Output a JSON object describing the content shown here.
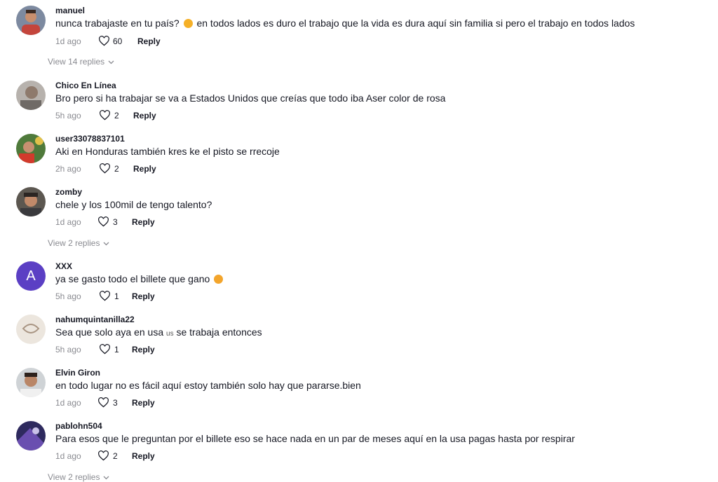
{
  "comments": [
    {
      "username": "manuel",
      "text_before": "nunca trabajaste en tu país?",
      "emoji": "laughing-face-emoji",
      "text_after": " en todos lados es duro el trabajo que la vida es dura aquí sin familia si pero el trabajo en todos lados",
      "time": "1d ago",
      "likes": "60",
      "reply": "Reply",
      "avatar": "photo"
    },
    {
      "username": "Chico En Línea",
      "text": "Bro pero si ha trabajar se va a Estados Unidos que creías que todo iba Aser color de rosa",
      "time": "5h ago",
      "likes": "2",
      "reply": "Reply",
      "avatar": "photo"
    },
    {
      "username": "user33078837101",
      "text": "Aki en Honduras también kres ke el pisto se rrecoje",
      "time": "2h ago",
      "likes": "2",
      "reply": "Reply",
      "avatar": "photo"
    },
    {
      "username": "zomby",
      "text": "chele y los 100mil de tengo talento?",
      "time": "1d ago",
      "likes": "3",
      "reply": "Reply",
      "avatar": "photo"
    },
    {
      "username": "XXX",
      "text_before": "ya se gasto todo el billete que gano",
      "emoji": "flushed-face-emoji",
      "text_after": "",
      "time": "5h ago",
      "likes": "1",
      "reply": "Reply",
      "avatar": "letter",
      "avatar_letter": "A"
    },
    {
      "username": "nahumquintanilla22",
      "text_before": "Sea que solo aya en usa ",
      "small": "us",
      "text_after": " se trabaja entonces",
      "time": "5h ago",
      "likes": "1",
      "reply": "Reply",
      "avatar": "photo"
    },
    {
      "username": "Elvin Giron",
      "text": "en todo lugar no es fácil aquí estoy también solo hay que pararse.bien",
      "time": "1d ago",
      "likes": "3",
      "reply": "Reply",
      "avatar": "photo"
    },
    {
      "username": "pablohn504",
      "text": "Para esos que le preguntan por el billete eso se hace nada en un par de meses aquí en la usa pagas hasta por respirar",
      "time": "1d ago",
      "likes": "2",
      "reply": "Reply",
      "avatar": "photo"
    }
  ],
  "view_replies": [
    "View 14 replies",
    "View 2 replies",
    "View 2 replies"
  ],
  "colors": {
    "muted": "#8a8b91",
    "text": "#161823",
    "letter_avatar_bg": "#5b3fc4",
    "emoji": "#f5a623"
  }
}
